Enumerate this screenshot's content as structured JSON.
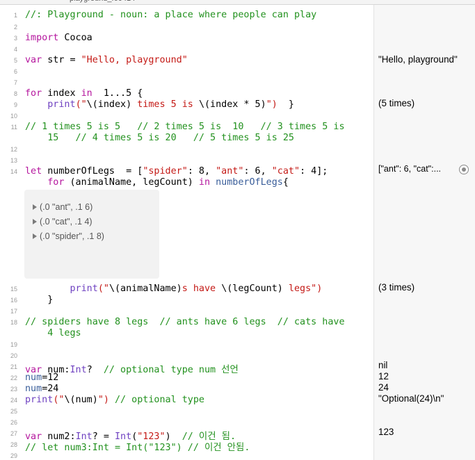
{
  "titlebar": {
    "file": "playground_f60414"
  },
  "lines": [
    {
      "n": "1",
      "t": [
        [
          "c",
          "//: Playground - noun: a place where people can play"
        ]
      ]
    },
    {
      "n": "2",
      "t": []
    },
    {
      "n": "3",
      "t": [
        [
          "k",
          "import"
        ],
        [
          "p",
          " Cocoa"
        ]
      ]
    },
    {
      "n": "4",
      "t": []
    },
    {
      "n": "5",
      "t": [
        [
          "k",
          "var"
        ],
        [
          "p",
          " str = "
        ],
        [
          "s",
          "\"Hello, playground\""
        ]
      ]
    },
    {
      "n": "6",
      "t": []
    },
    {
      "n": "7",
      "t": []
    },
    {
      "n": "8",
      "t": [
        [
          "k",
          "for"
        ],
        [
          "p",
          " index "
        ],
        [
          "k",
          "in"
        ],
        [
          "p",
          "  1...5 {"
        ]
      ]
    },
    {
      "n": "9",
      "t": [
        [
          "p",
          "    "
        ],
        [
          "y",
          "print"
        ],
        [
          "s",
          "(\""
        ],
        [
          "p",
          "\\(index) "
        ],
        [
          "s",
          "times 5 is "
        ],
        [
          "p",
          "\\(index * 5)"
        ],
        [
          "s",
          "\")"
        ],
        [
          "p",
          "  }"
        ]
      ]
    },
    {
      "n": "10",
      "t": []
    },
    {
      "n": "11",
      "t": [
        [
          "c",
          "// 1 times 5 is 5   // 2 times 5 is  10   // 3 times 5 is"
        ]
      ]
    },
    {
      "n": "",
      "t": [
        [
          "c",
          "    15   // 4 times 5 is 20   // 5 times 5 is 25"
        ]
      ]
    },
    {
      "n": "12",
      "t": []
    },
    {
      "n": "13",
      "t": []
    },
    {
      "n": "14",
      "t": [
        [
          "k",
          "let"
        ],
        [
          "p",
          " numberOfLegs  = ["
        ],
        [
          "s",
          "\"spider\""
        ],
        [
          "p",
          ": 8, "
        ],
        [
          "s",
          "\"ant\""
        ],
        [
          "p",
          ": 6, "
        ],
        [
          "s",
          "\"cat\""
        ],
        [
          "p",
          ": 4];"
        ]
      ]
    },
    {
      "n": "",
      "t": [
        [
          "p",
          "    "
        ],
        [
          "k",
          "for"
        ],
        [
          "p",
          " (animalName, legCount) "
        ],
        [
          "k",
          "in"
        ],
        [
          "p",
          " "
        ],
        [
          "i",
          "numberOfLegs"
        ],
        [
          "p",
          "{"
        ]
      ]
    },
    {
      "n": "15",
      "t": [
        [
          "p",
          "        "
        ],
        [
          "y",
          "print"
        ],
        [
          "s",
          "(\""
        ],
        [
          "p",
          "\\(animalName)"
        ],
        [
          "s",
          "s have "
        ],
        [
          "p",
          "\\(legCount) "
        ],
        [
          "s",
          "legs\")"
        ]
      ]
    },
    {
      "n": "16",
      "t": [
        [
          "p",
          "    }"
        ]
      ]
    },
    {
      "n": "17",
      "t": []
    },
    {
      "n": "18",
      "t": [
        [
          "c",
          "// spiders have 8 legs  // ants have 6 legs  // cats have"
        ]
      ]
    },
    {
      "n": "",
      "t": [
        [
          "c",
          "    4 legs"
        ]
      ]
    },
    {
      "n": "19",
      "t": []
    },
    {
      "n": "20",
      "t": []
    },
    {
      "n": "21",
      "t": [
        [
          "k",
          "var"
        ],
        [
          "p",
          " num:"
        ],
        [
          "y",
          "Int"
        ],
        [
          "p",
          "?  "
        ],
        [
          "c",
          "// optional type num 선언"
        ]
      ]
    },
    {
      "n": "22",
      "t": [
        [
          "i",
          "num"
        ],
        [
          "p",
          "=12"
        ]
      ]
    },
    {
      "n": "23",
      "t": [
        [
          "i",
          "num"
        ],
        [
          "p",
          "=24"
        ]
      ]
    },
    {
      "n": "24",
      "t": [
        [
          "y",
          "print"
        ],
        [
          "s",
          "(\""
        ],
        [
          "p",
          "\\(num)"
        ],
        [
          "s",
          "\")"
        ],
        [
          "p",
          " "
        ],
        [
          "c",
          "// optional type"
        ]
      ]
    },
    {
      "n": "25",
      "t": []
    },
    {
      "n": "26",
      "t": []
    },
    {
      "n": "27",
      "t": [
        [
          "k",
          "var"
        ],
        [
          "p",
          " num2:"
        ],
        [
          "y",
          "Int"
        ],
        [
          "p",
          "? = "
        ],
        [
          "y",
          "Int"
        ],
        [
          "p",
          "("
        ],
        [
          "s",
          "\"123\""
        ],
        [
          "p",
          ")  "
        ],
        [
          "c",
          "// 이건 됨."
        ]
      ]
    },
    {
      "n": "28",
      "t": [
        [
          "c",
          "// let num3:Int = Int(\"123\") // 이건 안됨."
        ]
      ]
    },
    {
      "n": "29",
      "t": []
    }
  ],
  "results": {
    "r5": "\"Hello, playground\"",
    "r9": "(5 times)",
    "r14": "[\"ant\": 6, \"cat\":...",
    "r15": "(3 times)",
    "r21": "nil",
    "r22": "12",
    "r23": "24",
    "r24": "\"Optional(24)\\n\"",
    "r27": "123"
  },
  "inline_result": {
    "items": [
      "(.0 \"ant\", .1 6)",
      "(.0 \"cat\", .1 4)",
      "(.0 \"spider\", .1 8)"
    ]
  }
}
